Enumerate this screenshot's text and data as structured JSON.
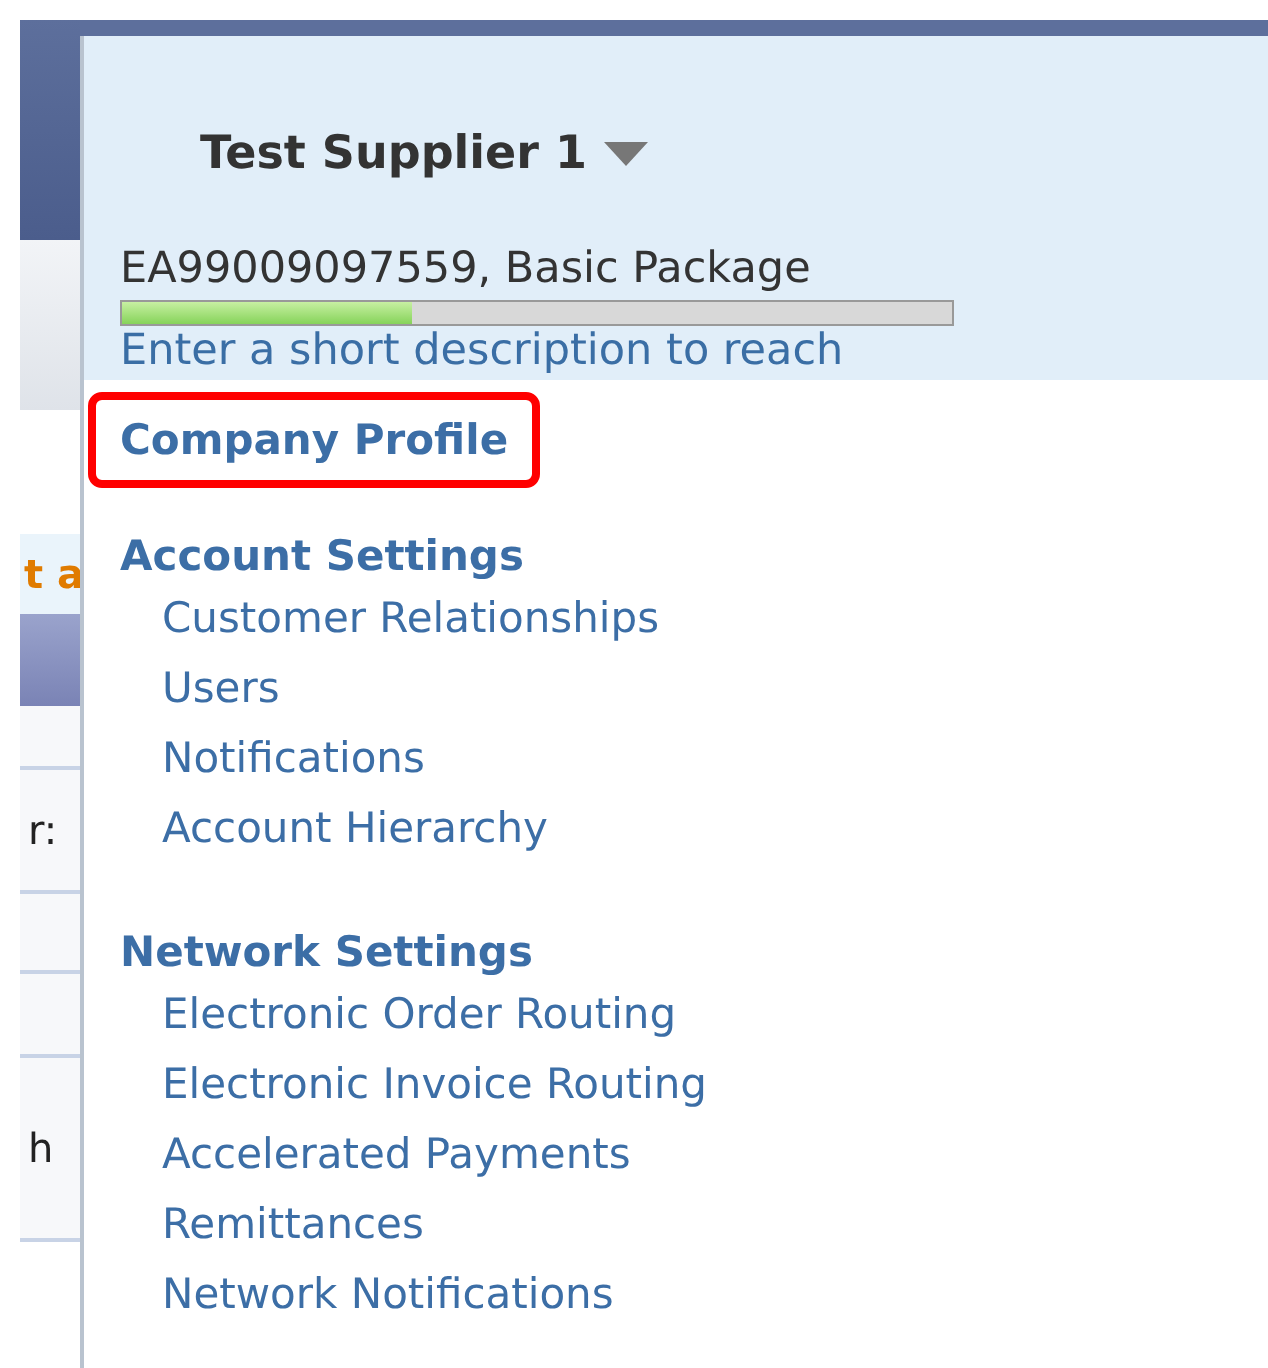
{
  "background_fragments": [
    {
      "text": "t a",
      "kind": "accent"
    },
    {
      "text": "r:",
      "kind": "plain"
    },
    {
      "text": "h",
      "kind": "plain"
    }
  ],
  "header": {
    "title": "Test Supplier 1",
    "account": "EA99009097559, Basic Package",
    "progress": {
      "level": 0.35
    },
    "hint": "Enter a short description to reach"
  },
  "menu": {
    "sections": [
      {
        "title": "Company Profile",
        "highlighted": true
      },
      {
        "title": "Account Settings",
        "highlighted": false,
        "items": [
          "Customer Relationships",
          "Users",
          "Notifications",
          "Account Hierarchy"
        ]
      },
      {
        "title": "Network Settings",
        "highlighted": false,
        "items": [
          "Electronic Order Routing",
          "Electronic Invoice Routing",
          "Accelerated Payments",
          "Remittances",
          "Network Notifications"
        ]
      }
    ]
  }
}
